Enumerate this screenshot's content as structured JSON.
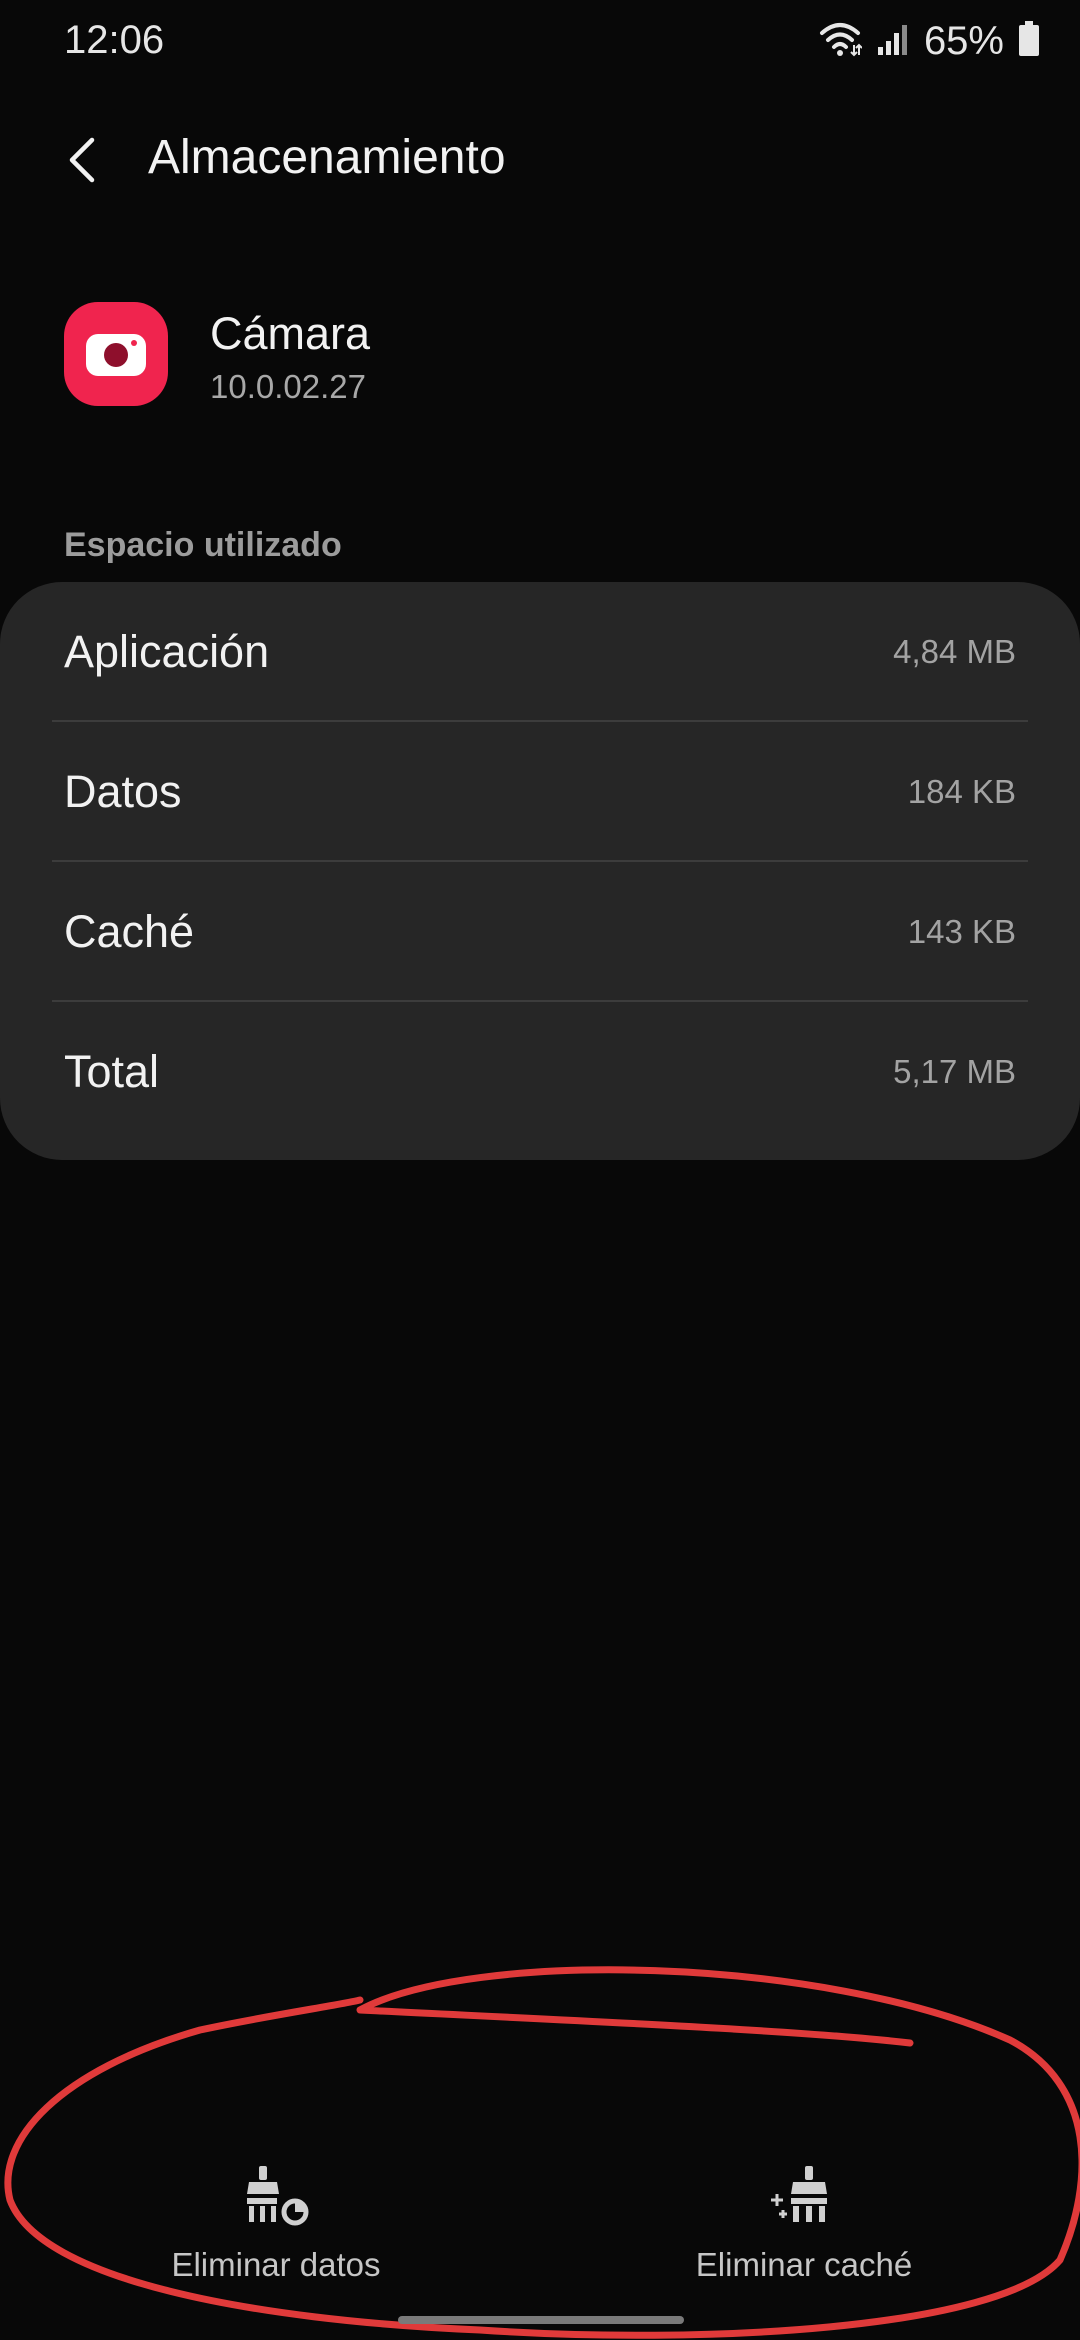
{
  "status_bar": {
    "time": "12:06",
    "battery_percent": "65%",
    "icons": [
      "wifi-icon",
      "signal-icon",
      "battery-icon"
    ]
  },
  "header": {
    "back_icon": "chevron-left-icon",
    "title": "Almacenamiento"
  },
  "app": {
    "name": "Cámara",
    "version": "10.0.02.27",
    "icon": "camera-icon",
    "icon_color": "#f0244e"
  },
  "storage": {
    "section_label": "Espacio utilizado",
    "rows": [
      {
        "label": "Aplicación",
        "value": "4,84 MB"
      },
      {
        "label": "Datos",
        "value": "184 KB"
      },
      {
        "label": "Caché",
        "value": "143 KB"
      },
      {
        "label": "Total",
        "value": "5,17 MB"
      }
    ]
  },
  "actions": {
    "clear_data": {
      "label": "Eliminar datos",
      "icon": "clear-data-icon"
    },
    "clear_cache": {
      "label": "Eliminar caché",
      "icon": "clear-cache-icon"
    }
  },
  "annotation": {
    "shape": "hand-drawn-ellipse",
    "color": "#e03a3a"
  },
  "colors": {
    "background": "#080808",
    "card": "#262626",
    "text_primary": "#f2f2f2",
    "text_secondary": "#a3a3a3"
  }
}
